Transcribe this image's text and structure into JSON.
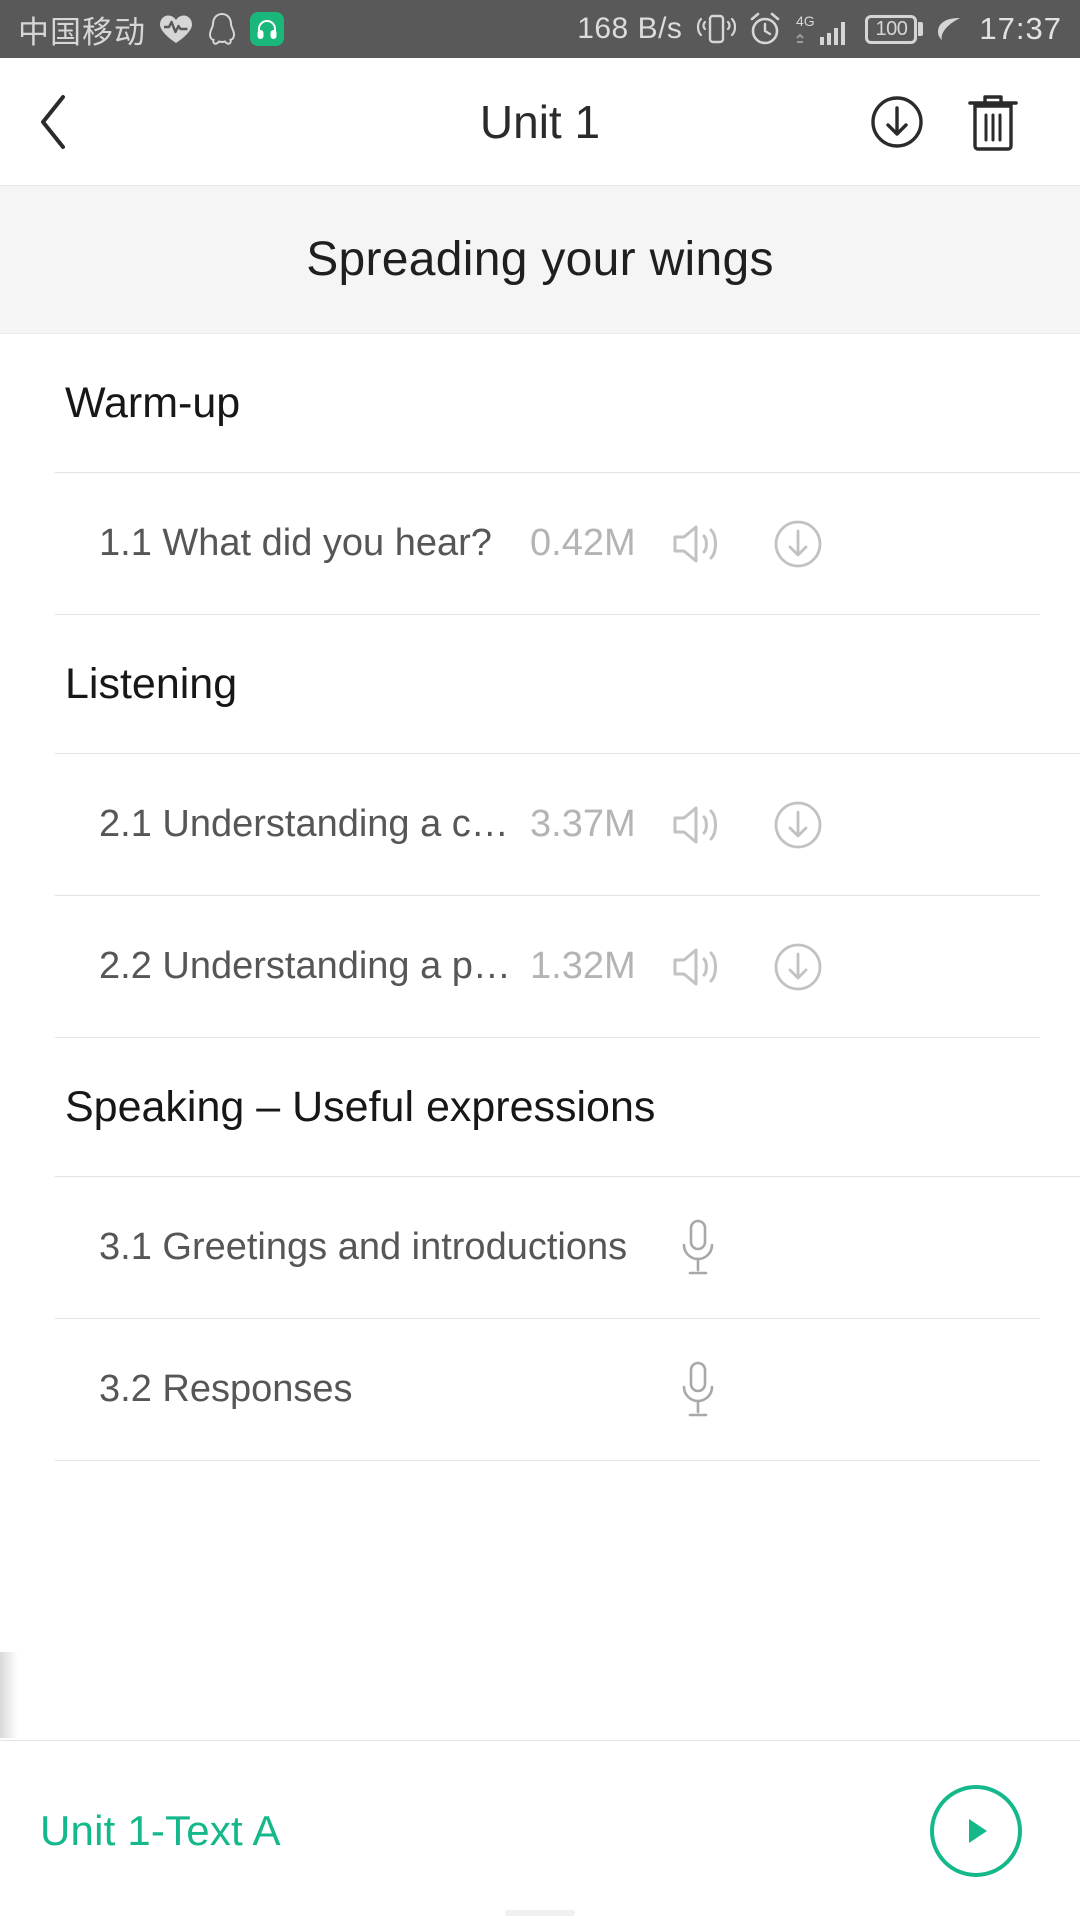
{
  "status_bar": {
    "carrier": "中国移动",
    "network_speed": "168 B/s",
    "battery_level": "100",
    "time": "17:37",
    "icons": [
      "heartbeat-icon",
      "qq-icon",
      "headphones-icon",
      "vibrate-icon",
      "alarm-icon",
      "4g-signal-icon",
      "battery-icon",
      "leaf-icon"
    ],
    "signal_label": "4G",
    "background_color": "#595959"
  },
  "appbar": {
    "title": "Unit 1",
    "back_label": "Back",
    "download_label": "Download all",
    "delete_label": "Delete"
  },
  "banner": {
    "title": "Spreading your wings",
    "background_color": "#f5f5f5"
  },
  "sections": [
    {
      "heading": "Warm-up",
      "rows": [
        {
          "title": "1.1 What did you hear?",
          "size": "0.42M",
          "has_speaker": true,
          "has_download": true,
          "has_mic": false
        }
      ]
    },
    {
      "heading": "Listening",
      "rows": [
        {
          "title": "2.1 Understanding a c…",
          "size": "3.37M",
          "has_speaker": true,
          "has_download": true,
          "has_mic": false
        },
        {
          "title": "2.2 Understanding a p…",
          "size": "1.32M",
          "has_speaker": true,
          "has_download": true,
          "has_mic": false
        }
      ]
    },
    {
      "heading": "Speaking – Useful expressions",
      "rows": [
        {
          "title": "3.1 Greetings and introductions",
          "size": "",
          "has_speaker": false,
          "has_download": false,
          "has_mic": true
        },
        {
          "title": "3.2 Responses",
          "size": "",
          "has_speaker": false,
          "has_download": false,
          "has_mic": true
        }
      ]
    }
  ],
  "player": {
    "track_title": "Unit 1-Text A",
    "play_label": "Play",
    "accent_color": "#14b88a"
  }
}
